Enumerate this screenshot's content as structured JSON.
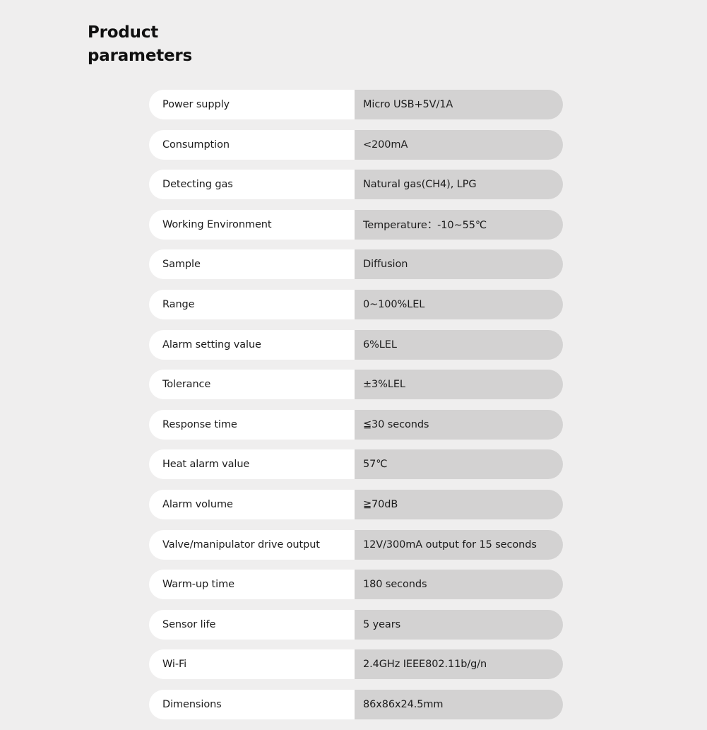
{
  "page": {
    "title": "Product\nparameters",
    "background_color": "#efeeee"
  },
  "theme": {
    "label_cell_color": "#ffffff",
    "value_cell_color": "#d3d2d2",
    "text_color": "#1c1c1c"
  },
  "table": {
    "rows": [
      {
        "label": "Power supply",
        "value": "Micro USB+5V/1A"
      },
      {
        "label": "Consumption",
        "value": "<200mA"
      },
      {
        "label": "Detecting gas",
        "value": "Natural gas(CH4), LPG"
      },
      {
        "label": "Working Environment",
        "value": "Temperature：-10~55℃"
      },
      {
        "label": "Sample",
        "value": "Diffusion"
      },
      {
        "label": "Range",
        "value": "0~100%LEL"
      },
      {
        "label": "Alarm setting value",
        "value": "6%LEL"
      },
      {
        "label": "Tolerance",
        "value": "±3%LEL"
      },
      {
        "label": "Response time",
        "value": "≦30 seconds"
      },
      {
        "label": "Heat alarm value",
        "value": "57℃"
      },
      {
        "label": "Alarm volume",
        "value": "≧70dB"
      },
      {
        "label": "Valve/manipulator drive output",
        "value": "12V/300mA output for 15 seconds"
      },
      {
        "label": "Warm-up time",
        "value": "180 seconds"
      },
      {
        "label": "Sensor life",
        "value": "5 years"
      },
      {
        "label": "Wi-Fi",
        "value": "2.4GHz IEEE802.11b/g/n"
      },
      {
        "label": "Dimensions",
        "value": "86x86x24.5mm"
      }
    ]
  }
}
